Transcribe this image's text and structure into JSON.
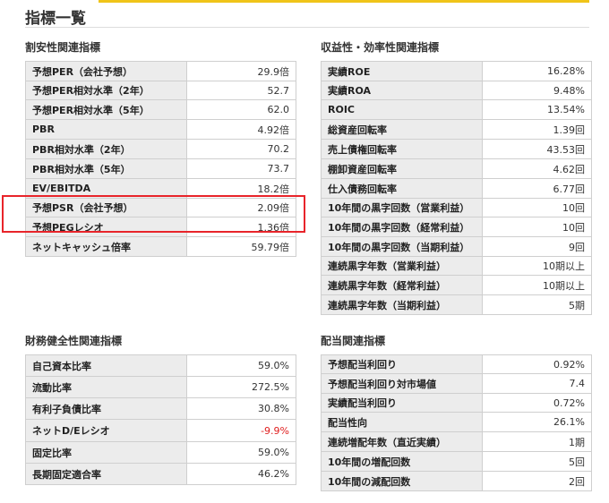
{
  "page": {
    "title": "指標一覧"
  },
  "colors": {
    "accent": "#f0c419",
    "highlight": "#e8242a",
    "negative": "#e02020"
  },
  "sections": {
    "valuation": {
      "title": "割安性関連指標",
      "rows": [
        {
          "label": "予想PER（会社予想）",
          "value": "29.9倍"
        },
        {
          "label": "予想PER相対水準（2年）",
          "value": "52.7"
        },
        {
          "label": "予想PER相対水準（5年）",
          "value": "62.0"
        },
        {
          "label": "PBR",
          "value": "4.92倍"
        },
        {
          "label": "PBR相対水準（2年）",
          "value": "70.2"
        },
        {
          "label": "PBR相対水準（5年）",
          "value": "73.7"
        },
        {
          "label": "EV/EBITDA",
          "value": "18.2倍"
        },
        {
          "label": "予想PSR（会社予想）",
          "value": "2.09倍"
        },
        {
          "label": "予想PEGレシオ",
          "value": "1.36倍"
        },
        {
          "label": "ネットキャッシュ倍率",
          "value": "59.79倍"
        }
      ]
    },
    "profitability": {
      "title": "収益性・効率性関連指標",
      "rows": [
        {
          "label": "実績ROE",
          "value": "16.28%"
        },
        {
          "label": "実績ROA",
          "value": "9.48%"
        },
        {
          "label": "ROIC",
          "value": "13.54%"
        },
        {
          "label": "総資産回転率",
          "value": "1.39回"
        },
        {
          "label": "売上債権回転率",
          "value": "43.53回"
        },
        {
          "label": "棚卸資産回転率",
          "value": "4.62回"
        },
        {
          "label": "仕入債務回転率",
          "value": "6.77回"
        },
        {
          "label": "10年間の黒字回数（営業利益）",
          "value": "10回"
        },
        {
          "label": "10年間の黒字回数（経常利益）",
          "value": "10回"
        },
        {
          "label": "10年間の黒字回数（当期利益）",
          "value": "9回"
        },
        {
          "label": "連続黒字年数（営業利益）",
          "value": "10期以上"
        },
        {
          "label": "連続黒字年数（経常利益）",
          "value": "10期以上"
        },
        {
          "label": "連続黒字年数（当期利益）",
          "value": "5期"
        }
      ]
    },
    "financial_health": {
      "title": "財務健全性関連指標",
      "rows": [
        {
          "label": "自己資本比率",
          "value": "59.0%"
        },
        {
          "label": "流動比率",
          "value": "272.5%"
        },
        {
          "label": "有利子負債比率",
          "value": "30.8%"
        },
        {
          "label": "ネットD/Eレシオ",
          "value": "-9.9%"
        },
        {
          "label": "固定比率",
          "value": "59.0%"
        },
        {
          "label": "長期固定適合率",
          "value": "46.2%"
        }
      ]
    },
    "dividend": {
      "title": "配当関連指標",
      "rows": [
        {
          "label": "予想配当利回り",
          "value": "0.92%"
        },
        {
          "label": "予想配当利回り対市場値",
          "value": "7.4"
        },
        {
          "label": "実績配当利回り",
          "value": "0.72%"
        },
        {
          "label": "配当性向",
          "value": "26.1%"
        },
        {
          "label": "連続増配年数（直近実績）",
          "value": "1期"
        },
        {
          "label": "10年間の増配回数",
          "value": "5回"
        },
        {
          "label": "10年間の減配回数",
          "value": "2回"
        }
      ]
    }
  }
}
